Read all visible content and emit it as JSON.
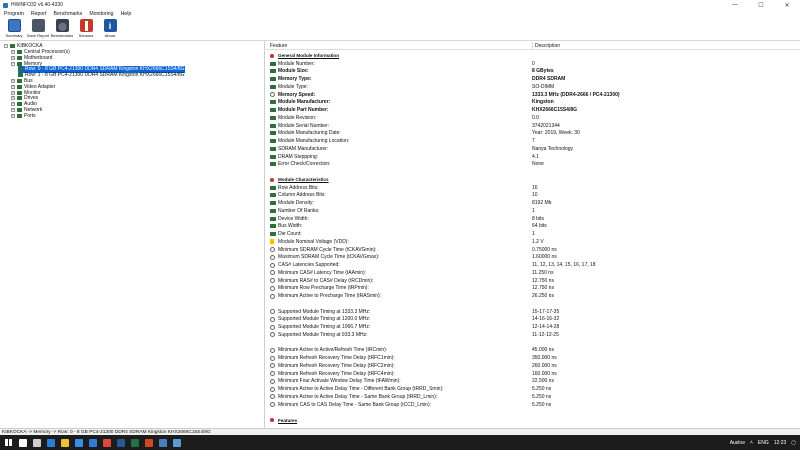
{
  "window": {
    "title": "HWiNFO32 v6.40-4330",
    "controls": [
      "—",
      "☐",
      "✕"
    ]
  },
  "menu": [
    "Program",
    "Report",
    "Benchmarks",
    "Monitoring",
    "Help"
  ],
  "toolbar": [
    {
      "label": "Summary",
      "icon": "summary-icon"
    },
    {
      "label": "Save Report",
      "icon": "save-icon"
    },
    {
      "label": "Benchmarks",
      "icon": "benchmark-icon"
    },
    {
      "label": "Sensors",
      "icon": "sensors-icon"
    },
    {
      "label": "About",
      "icon": "about-icon"
    }
  ],
  "tree": [
    {
      "label": "KIBKOCKA",
      "level": 0,
      "expander": "−"
    },
    {
      "label": "Central Processor(s)",
      "level": 1,
      "expander": "+"
    },
    {
      "label": "Motherboard",
      "level": 1,
      "expander": "+"
    },
    {
      "label": "Memory",
      "level": 1,
      "expander": "−"
    },
    {
      "label": "Row: 0 - 8 GB PC4-21300 DDR4 SDRAM Kingston KHX2666C15S4/8G",
      "level": 2,
      "selected": true
    },
    {
      "label": "Row: 1 - 8 GB PC4-21300 DDR4 SDRAM Kingston KHX2666C15S4/8G",
      "level": 2
    },
    {
      "label": "Bus",
      "level": 1,
      "expander": "+"
    },
    {
      "label": "Video Adapter",
      "level": 1,
      "expander": "+"
    },
    {
      "label": "Monitor",
      "level": 1,
      "expander": "+"
    },
    {
      "label": "Drives",
      "level": 1,
      "expander": "+"
    },
    {
      "label": "Audio",
      "level": 1,
      "expander": "+"
    },
    {
      "label": "Network",
      "level": 1,
      "expander": "+"
    },
    {
      "label": "Ports",
      "level": 1,
      "expander": "+"
    }
  ],
  "details": {
    "col_feature": "Feature",
    "col_description": "Description",
    "rows": [
      {
        "type": "section",
        "f": "General Module Information",
        "icon": "sec"
      },
      {
        "f": "Module Number:",
        "d": "0"
      },
      {
        "f": "Module Size:",
        "d": "8 GBytes",
        "bold": true
      },
      {
        "f": "Memory Type:",
        "d": "DDR4 SDRAM",
        "bold": true
      },
      {
        "f": "Module Type:",
        "d": "SO-DIMM"
      },
      {
        "f": "Memory Speed:",
        "d": "1333.3 MHz (DDR4-2666 / PC4-21300)",
        "bold": true,
        "icon": "clock"
      },
      {
        "f": "Module Manufacturer:",
        "d": "Kingston",
        "bold": true
      },
      {
        "f": "Module Part Number:",
        "d": "KHX2666C15S4/8G",
        "bold": true
      },
      {
        "f": "Module Revision:",
        "d": "0.0"
      },
      {
        "f": "Module Serial Number:",
        "d": "3742021344"
      },
      {
        "f": "Module Manufacturing Date:",
        "d": "Year: 2019, Week: 30"
      },
      {
        "f": "Module Manufacturing Location:",
        "d": "7"
      },
      {
        "f": "SDRAM Manufacturer:",
        "d": "Nanya Technology"
      },
      {
        "f": "DRAM Steppping:",
        "d": "4.1"
      },
      {
        "f": "Error Check/Correction:",
        "d": "None"
      },
      {
        "type": "blank"
      },
      {
        "type": "section",
        "f": "Module Characteristics",
        "icon": "sec"
      },
      {
        "f": "Row Address Bits:",
        "d": "16"
      },
      {
        "f": "Column Address Bits:",
        "d": "10"
      },
      {
        "f": "Module Density:",
        "d": "8192 Mb"
      },
      {
        "f": "Number Of Ranks:",
        "d": "1"
      },
      {
        "f": "Device Width:",
        "d": "8 bits"
      },
      {
        "f": "Bus Width:",
        "d": "64 bits"
      },
      {
        "f": "Die Count:",
        "d": "1"
      },
      {
        "f": "Module Nominal Voltage (VDD):",
        "d": "1.2 V",
        "icon": "volt"
      },
      {
        "f": "Minimum SDRAM Cycle Time (tCKAVGmin):",
        "d": "0.75000 ns",
        "icon": "clock"
      },
      {
        "f": "Maximum SDRAM Cycle Time (tCKAVGmax):",
        "d": "1.60000 ns",
        "icon": "clock"
      },
      {
        "f": "CAS# Latencies Supported:",
        "d": "11, 12, 13, 14, 15, 16, 17, 18",
        "icon": "clock"
      },
      {
        "f": "Minimum CAS# Latency Time (tAAmin):",
        "d": "11.250 ns",
        "icon": "clock"
      },
      {
        "f": "Minimum RAS# to CAS# Delay (tRCDmin):",
        "d": "12.750 ns",
        "icon": "clock"
      },
      {
        "f": "Minimum Row Precharge Time (tRPmin):",
        "d": "12.750 ns",
        "icon": "clock"
      },
      {
        "f": "Minimum Active to Precharge Time (tRASmin):",
        "d": "26.250 ns",
        "icon": "clock"
      },
      {
        "type": "blank"
      },
      {
        "f": "Supported Module Timing at 1333.3 MHz:",
        "d": "15-17-17-35",
        "icon": "clock"
      },
      {
        "f": "Supported Module Timing at 1200.0 MHz:",
        "d": "14-16-16-32",
        "icon": "clock"
      },
      {
        "f": "Supported Module Timing at 1066.7 MHz:",
        "d": "12-14-14-28",
        "icon": "clock"
      },
      {
        "f": "Supported Module Timing at 933.3 MHz:",
        "d": "11-12-12-25",
        "icon": "clock"
      },
      {
        "type": "blank"
      },
      {
        "f": "Minimum Active to Active/Refresh Time (tRCmin):",
        "d": "45.000 ns",
        "icon": "clock"
      },
      {
        "f": "Minimum Refresh Recovery Time Delay (tRFC1min):",
        "d": "350.000 ns",
        "icon": "clock"
      },
      {
        "f": "Minimum Refresh Recovery Time Delay (tRFC2min):",
        "d": "260.000 ns",
        "icon": "clock"
      },
      {
        "f": "Minimum Refresh Recovery Time Delay (tRFC4min):",
        "d": "160.000 ns",
        "icon": "clock"
      },
      {
        "f": "Minimum Four Activate Window Delay Time (tFAWmin):",
        "d": "22.500 ns",
        "icon": "clock"
      },
      {
        "f": "Minimum Active to Active Delay Time - Different Bank Group (tRRD_Smin):",
        "d": "5.250 ns",
        "icon": "clock"
      },
      {
        "f": "Minimum Active to Active Delay Time - Same Bank Group (tRRD_Lmin):",
        "d": "5.250 ns",
        "icon": "clock"
      },
      {
        "f": "Minimum CAS to CAS Delay Time - Same Bank Group (tCCD_Lmin):",
        "d": "5.250 ns",
        "icon": "clock"
      },
      {
        "type": "blank"
      },
      {
        "type": "section",
        "f": "Features",
        "icon": "sec"
      }
    ]
  },
  "status": "KIBKOCKA -> Memory -> Row: 0 - 8 GB PC4-21300 DDR4 SDRAM Kingston KHX2666C15S4/8G",
  "taskbar": {
    "apps": [
      {
        "name": "search-taskbar-icon",
        "color": "#ffffff"
      },
      {
        "name": "task-view-icon",
        "color": "#cfcfcf"
      },
      {
        "name": "edge-icon",
        "color": "#2b7cd3"
      },
      {
        "name": "explorer-icon",
        "color": "#f3c12b"
      },
      {
        "name": "store-icon",
        "color": "#3a8ee6"
      },
      {
        "name": "mail-icon",
        "color": "#2f7bd6"
      },
      {
        "name": "chrome-icon",
        "color": "#e0483b"
      },
      {
        "name": "word-icon",
        "color": "#2b579a"
      },
      {
        "name": "excel-icon",
        "color": "#217346"
      },
      {
        "name": "powerpoint-icon",
        "color": "#d24726"
      },
      {
        "name": "hwinfo-icon",
        "color": "#4a7fc2"
      },
      {
        "name": "photos-icon",
        "color": "#5b9bd5"
      }
    ],
    "tray": {
      "weather": "Ausloe",
      "lang": "ENG",
      "time": "12:23"
    }
  }
}
